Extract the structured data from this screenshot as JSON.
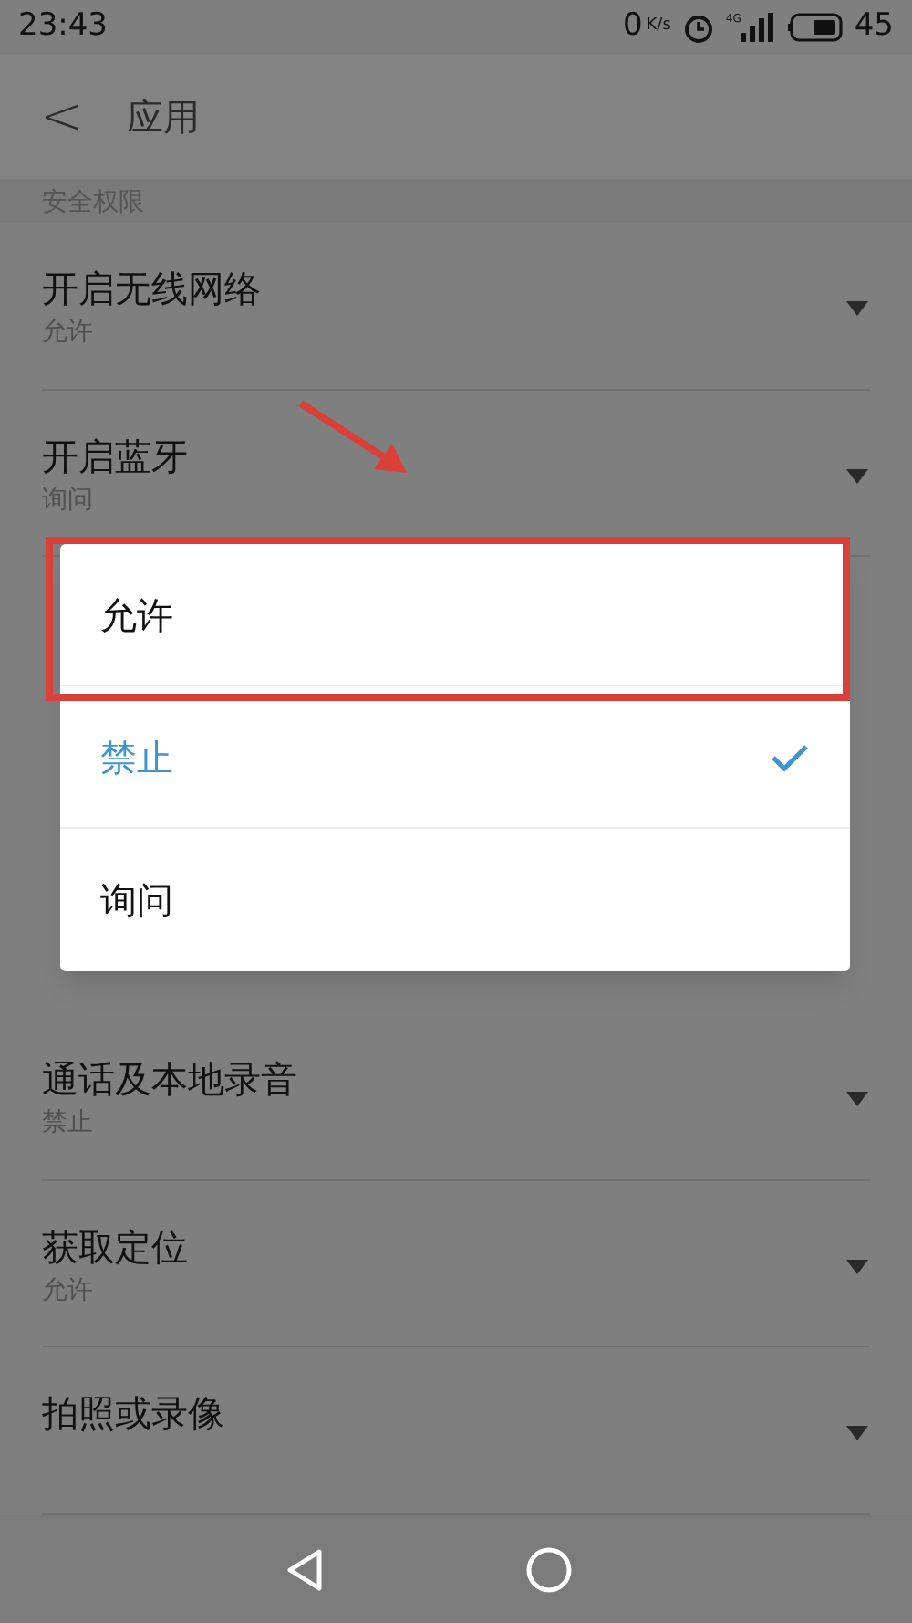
{
  "status_bar": {
    "time": "23:43",
    "speed_value": "0",
    "speed_unit": "K/s",
    "network": "4G",
    "battery": "45"
  },
  "header": {
    "back": "<",
    "title": "应用"
  },
  "section": "安全权限",
  "rows_top": [
    {
      "title": "开启无线网络",
      "value": "允许"
    },
    {
      "title": "开启蓝牙",
      "value": "询问"
    }
  ],
  "rows_bottom": [
    {
      "title": "通话及本地录音",
      "value": "禁止"
    },
    {
      "title": "获取定位",
      "value": "允许"
    },
    {
      "title": "拍照或录像"
    }
  ],
  "dialog": {
    "options": [
      {
        "label": "允许",
        "selected": false,
        "highlighted": true
      },
      {
        "label": "禁止",
        "selected": true,
        "highlighted": false
      },
      {
        "label": "询问",
        "selected": false,
        "highlighted": false
      }
    ]
  }
}
